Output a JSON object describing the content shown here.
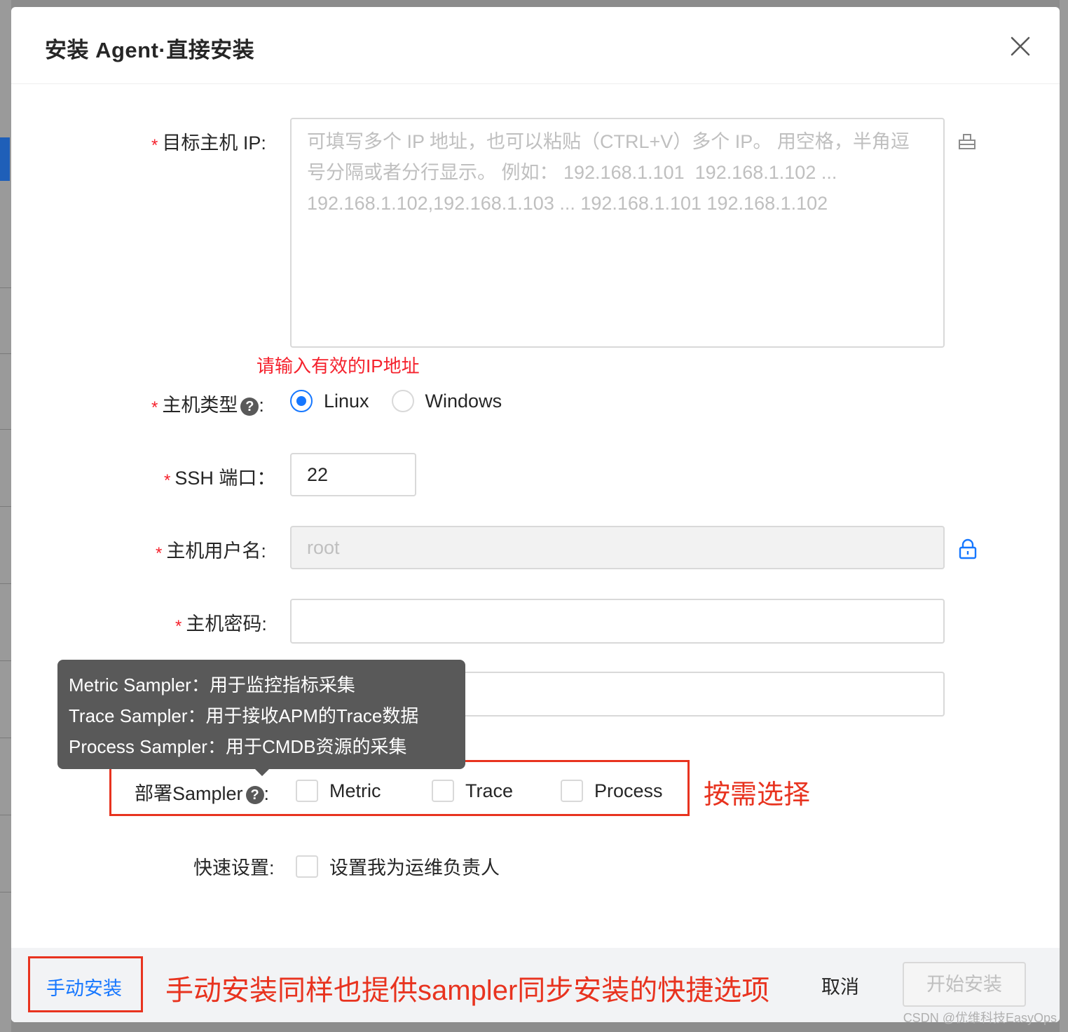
{
  "modal": {
    "title": "安装 Agent·直接安装"
  },
  "form": {
    "target_ip": {
      "label": "目标主机 IP",
      "colon": ":",
      "placeholder": "可填写多个 IP 地址，也可以粘贴（CTRL+V）多个 IP。 用空格，半角逗号分隔或者分行显示。 例如： 192.168.1.101  192.168.1.102 ... 192.168.1.102,192.168.1.103 ... 192.168.1.101 192.168.1.102",
      "value": "",
      "error": "请输入有效的IP地址",
      "side_icon": "host-picker-icon"
    },
    "host_type": {
      "label": "主机类型",
      "colon": ":",
      "options": [
        {
          "label": "Linux",
          "checked": true
        },
        {
          "label": "Windows",
          "checked": false
        }
      ]
    },
    "ssh_port": {
      "label": "SSH 端口",
      "colon": "：",
      "value": "22"
    },
    "username": {
      "label": "主机用户名",
      "colon": ":",
      "value": "root",
      "disabled": true,
      "side_icon": "lock-icon"
    },
    "password": {
      "label": "主机密码",
      "colon": ":",
      "value": ""
    },
    "extra_input": {
      "value": ""
    },
    "sampler": {
      "label": "部署Sampler",
      "colon": ":",
      "options": [
        {
          "label": "Metric",
          "checked": false
        },
        {
          "label": "Trace",
          "checked": false
        },
        {
          "label": "Process",
          "checked": false
        }
      ]
    },
    "quick_setting": {
      "label": "快速设置",
      "colon": ":",
      "option": "设置我为运维负责人"
    }
  },
  "tooltip": {
    "lines": [
      "Metric Sampler：用于监控指标采集",
      "Trace Sampler：用于接收APM的Trace数据",
      "Process Sampler：用于CMDB资源的采集"
    ]
  },
  "annotations": {
    "sampler_note": "按需选择",
    "footer_note": "手动安装同样也提供sampler同步安装的快捷选项"
  },
  "footer": {
    "manual_install": "手动安装",
    "cancel": "取消",
    "start_install": "开始安装"
  },
  "watermark": "CSDN @优维科技EasyOps",
  "colors": {
    "primary": "#1677ff",
    "required": "#f5222d",
    "annotation": "#e8331f",
    "tooltip_bg": "#595959"
  }
}
